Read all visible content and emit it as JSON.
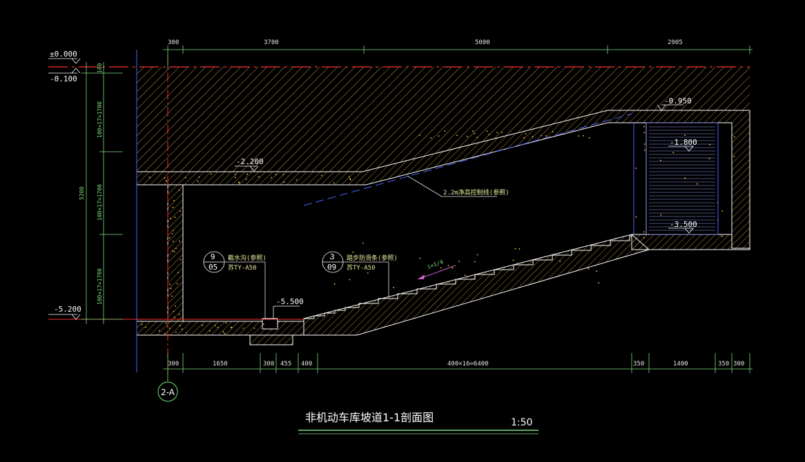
{
  "title": "非机动车库坡道1-1剖面图",
  "scale": "1:50",
  "grid_label": "2-A",
  "levels": {
    "zero": "±0.000",
    "l_0100": "-0.100",
    "l_5200": "-5.200",
    "l_0950": "-0.950",
    "l_1800": "-1.800",
    "l_2200": "-2.200",
    "l_3500": "-3.500",
    "l_5500": "-5.500"
  },
  "top_dims": [
    "300",
    "3700",
    "5000",
    "2905"
  ],
  "bottom_dims": [
    "300",
    "1650",
    "300",
    "455",
    "400",
    "400×16=6400",
    "350",
    "1400",
    "350",
    "300"
  ],
  "left_dims": {
    "total": "5200",
    "seg1": "100",
    "seg2": "100×17=1700",
    "seg3": "100×17=1700",
    "seg4": "100×17=1700"
  },
  "annotations": {
    "clearance": "2.2m净高控制线(参照)",
    "slope": "i=1/4",
    "callout1_top": "9",
    "callout1_bot": "05",
    "callout1_text": "截水沟(参照)",
    "callout1_ref": "苏TY-A50",
    "callout2_top": "3",
    "callout2_bot": "09",
    "callout2_text": "踏步防滑条(参照)",
    "callout2_ref": "苏TY-A50"
  }
}
